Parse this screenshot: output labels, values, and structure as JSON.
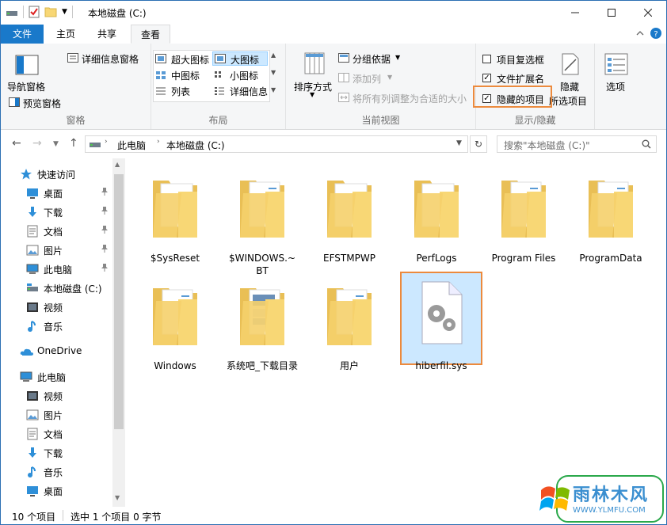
{
  "window": {
    "title": "本地磁盘 (C:)",
    "controls": [
      "minimize",
      "maximize",
      "close"
    ]
  },
  "ribbon_tabs": [
    {
      "label": "文件"
    },
    {
      "label": "主页"
    },
    {
      "label": "共享"
    },
    {
      "label": "查看"
    }
  ],
  "ribbon": {
    "panes": {
      "nav_pane": "导航窗格",
      "preview_pane": "预览窗格",
      "details_pane": "详细信息窗格",
      "group": "窗格"
    },
    "layout": {
      "extra_large": "超大图标",
      "large": "大图标",
      "medium": "中图标",
      "small": "小图标",
      "list": "列表",
      "details": "详细信息",
      "group": "布局"
    },
    "current_view": {
      "sort_by": "排序方式",
      "group_by": "分组依据",
      "add_columns": "添加列",
      "size_columns": "将所有列调整为合适的大小",
      "group": "当前视图"
    },
    "show_hide": {
      "item_checkboxes": "项目复选框",
      "file_extensions": "文件扩展名",
      "hidden_items": "隐藏的项目",
      "hide_selected_line1": "隐藏",
      "hide_selected_line2": "所选项目",
      "group": "显示/隐藏"
    },
    "options": "选项"
  },
  "address": {
    "crumbs": [
      "此电脑",
      "本地磁盘 (C:)"
    ],
    "search_placeholder": "搜索\"本地磁盘 (C:)\""
  },
  "nav": [
    {
      "label": "快速访问",
      "icon": "star-icon"
    },
    {
      "label": "桌面",
      "icon": "desktop-icon",
      "pinned": true
    },
    {
      "label": "下载",
      "icon": "download-icon",
      "pinned": true
    },
    {
      "label": "文档",
      "icon": "document-icon",
      "pinned": true
    },
    {
      "label": "图片",
      "icon": "picture-icon",
      "pinned": true
    },
    {
      "label": "此电脑",
      "icon": "computer-icon",
      "pinned": true
    },
    {
      "label": "本地磁盘 (C:)",
      "icon": "drive-icon"
    },
    {
      "label": "视频",
      "icon": "video-icon"
    },
    {
      "label": "音乐",
      "icon": "music-icon"
    },
    {
      "label": "OneDrive",
      "icon": "onedrive-icon"
    },
    {
      "label": "此电脑",
      "icon": "computer-icon"
    },
    {
      "label": "视频",
      "icon": "video-icon"
    },
    {
      "label": "图片",
      "icon": "picture-icon"
    },
    {
      "label": "文档",
      "icon": "document-icon"
    },
    {
      "label": "下载",
      "icon": "download-icon"
    },
    {
      "label": "音乐",
      "icon": "music-icon"
    },
    {
      "label": "桌面",
      "icon": "desktop-icon"
    }
  ],
  "files": [
    {
      "name": "$SysReset",
      "kind": "folder-empty"
    },
    {
      "name": "$WINDOWS.~BT",
      "kind": "folder-docs"
    },
    {
      "name": "EFSTMPWP",
      "kind": "folder-empty"
    },
    {
      "name": "PerfLogs",
      "kind": "folder-empty"
    },
    {
      "name": "Program Files",
      "kind": "folder-docs"
    },
    {
      "name": "ProgramData",
      "kind": "folder-docs"
    },
    {
      "name": "Windows",
      "kind": "folder-docs"
    },
    {
      "name": "系统吧_下载目录",
      "kind": "folder-pics"
    },
    {
      "name": "用户",
      "kind": "folder-docs"
    },
    {
      "name": "hiberfil.sys",
      "kind": "system-file",
      "selected": true
    }
  ],
  "status": {
    "count": "10 个项目",
    "selected": "选中 1 个项目  0 字节"
  },
  "watermark": {
    "brand": "雨林木风",
    "url": "WWW.YLMFU.COM"
  },
  "colors": {
    "accent": "#1979ca",
    "highlight": "#ec8a3d",
    "selection": "#cce8ff",
    "folder": "#f8d775"
  }
}
